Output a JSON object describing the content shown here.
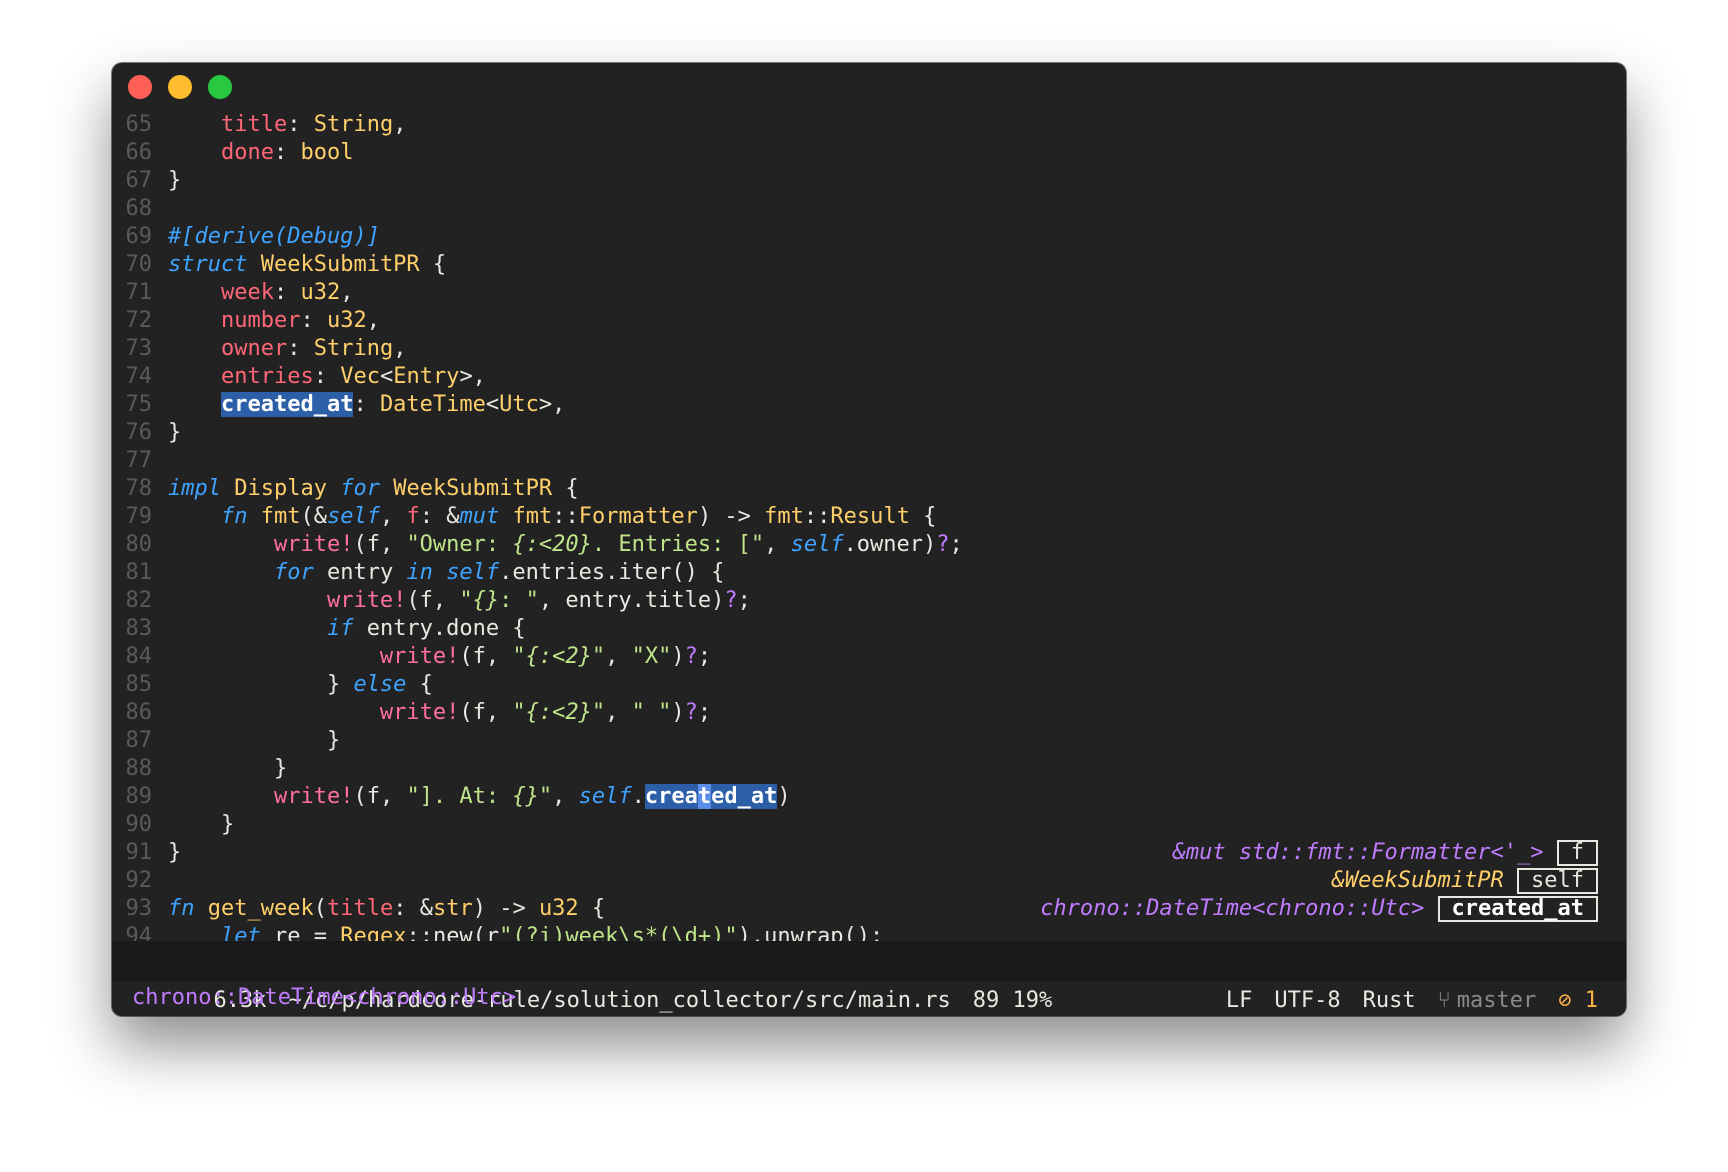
{
  "window": {
    "controls": {
      "close_color": "#ff5f57",
      "minimize_color": "#febc2e",
      "maximize_color": "#28c840"
    }
  },
  "editor": {
    "line_numbers": [
      "65",
      "66",
      "67",
      "68",
      "69",
      "70",
      "71",
      "72",
      "73",
      "74",
      "75",
      "76",
      "77",
      "78",
      "79",
      "80",
      "81",
      "82",
      "83",
      "84",
      "85",
      "86",
      "87",
      "88",
      "89",
      "90",
      "91",
      "92",
      "93",
      "94"
    ]
  },
  "hints": [
    {
      "type": "&mut std::fmt::Formatter<'_>",
      "label": "f"
    },
    {
      "type": "&WeekSubmitPR",
      "label": "self"
    },
    {
      "type": "chrono::DateTime<chrono::Utc>",
      "label": "created_at"
    }
  ],
  "statusbar": {
    "size": "6.3k",
    "path": "~/c/p/hardcore-rule/solution_collector/src/main.rs",
    "position": "89 19%",
    "line_ending": "LF",
    "encoding": "UTF-8",
    "language": "Rust",
    "branch_icon": "git-branch-icon",
    "branch": "master",
    "error_icon": "no-entry-icon",
    "errors": "1"
  },
  "echo_area": {
    "text": "chrono::DateTime<chrono::Utc>"
  },
  "colors": {
    "background": "#222222",
    "keyword": "#3ea3ff",
    "type": "#ffcf6a",
    "field": "#ff6677",
    "string": "#bfe58a",
    "selection": "#2d5ea8"
  }
}
